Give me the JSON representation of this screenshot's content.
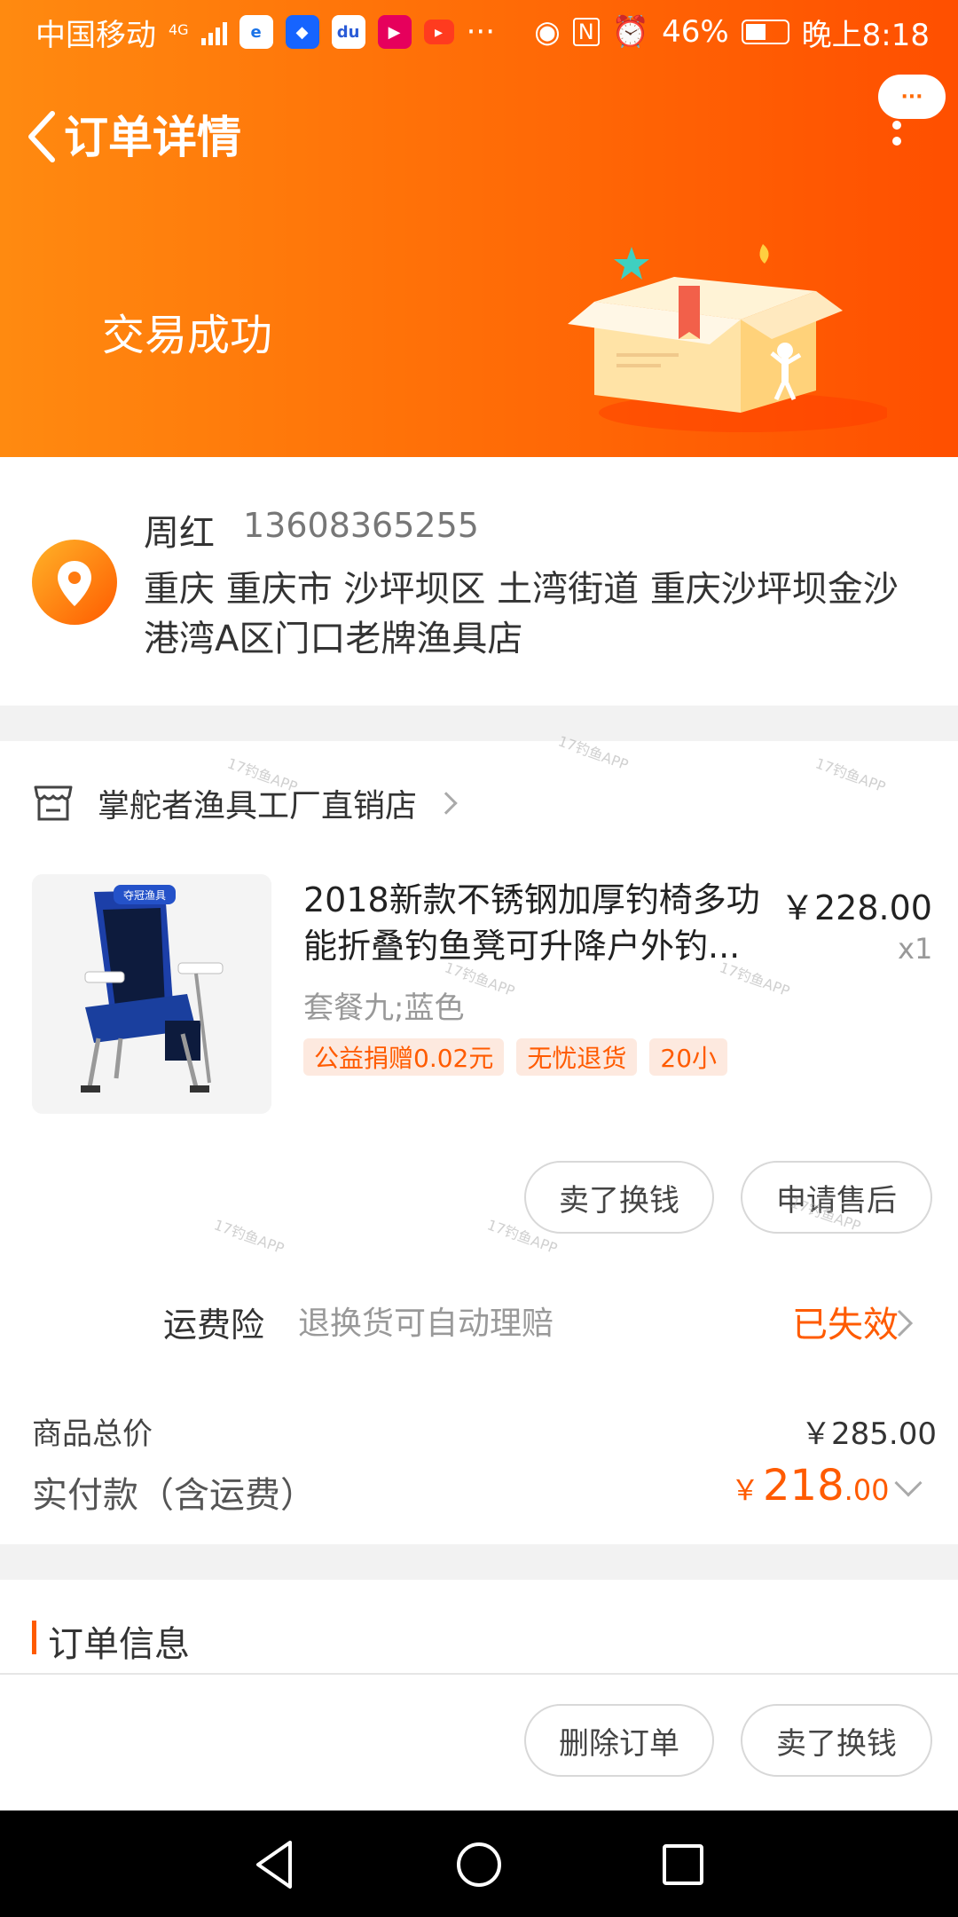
{
  "status_bar": {
    "carrier": "中国移动",
    "network": "4G",
    "battery": "46%",
    "time": "晚上8:18"
  },
  "header": {
    "title": "订单详情",
    "more_label": "···"
  },
  "order_status": "交易成功",
  "address": {
    "name": "周红",
    "phone": "13608365255",
    "detail": "重庆 重庆市 沙坪坝区 土湾街道 重庆沙坪坝金沙港湾A区门口老牌渔具店"
  },
  "shop": {
    "name": "掌舵者渔具工厂直销店"
  },
  "product": {
    "title": "2018新款不锈钢加厚钓椅多功能折叠钓鱼凳可升降户外钓...",
    "price": "￥228.00",
    "qty": "x1",
    "spec": "套餐九;蓝色",
    "tags": [
      "公益捐赠0.02元",
      "无忧退货",
      "20小"
    ],
    "image_brand": "夺冠渔具"
  },
  "actions_item": {
    "sell_label": "卖了换钱",
    "aftersale_label": "申请售后"
  },
  "insurance": {
    "label": "运费险",
    "desc": "退换货可自动理赔",
    "status": "已失效"
  },
  "totals": {
    "goods_label": "商品总价",
    "goods_value": "￥285.00",
    "paid_label": "实付款（含运费）",
    "paid_currency": "￥",
    "paid_integer": "218",
    "paid_cents": ".00"
  },
  "order_info": {
    "title": "订单信息"
  },
  "bottom_actions": {
    "delete_label": "删除订单",
    "sell_label": "卖了换钱"
  },
  "watermark": "17钓鱼APP",
  "colors": {
    "accent": "#ff5b00",
    "header_start": "#ff8a10",
    "header_end": "#ff4f00"
  }
}
